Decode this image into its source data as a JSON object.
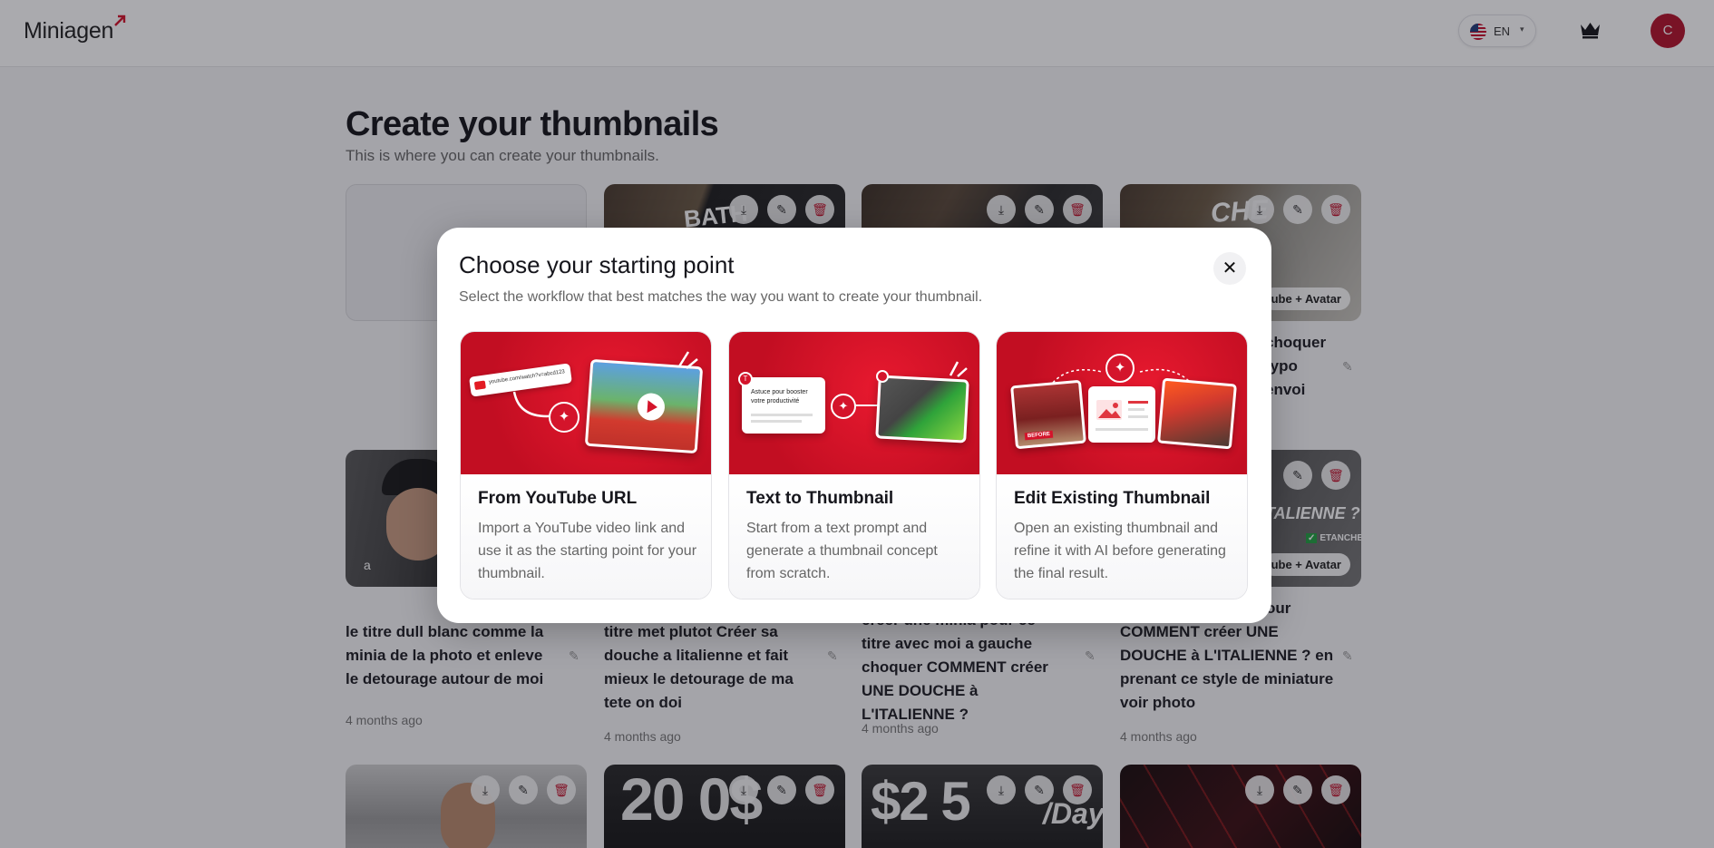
{
  "header": {
    "logo_text": "Miniagen",
    "language": "EN",
    "avatar_initial": "C"
  },
  "page": {
    "title": "Create your thumbnails",
    "subtitle": "This is where you can create your thumbnails."
  },
  "cards": {
    "r1c2_thumb_text": "BATH",
    "r1c4_thumb_text": "CHE",
    "r1c4_badge": "ube + Avatar",
    "r1c4_title": "choquer\ntypo\nenvoi",
    "r2c1_letter": "a",
    "r2c1_title": "le titre dull blanc comme la minia de la photo et enleve le detourage autour de moi",
    "r2c1_time": "4 months ago",
    "r2c2_title": "titre met plutot Créer sa douche a litalienne et fait mieux le detourage de ma tete on doi",
    "r2c2_time": "4 months ago",
    "r2c3_title": "créer une minia pour ce titre avec moi a gauche choquer COMMENT créer UNE DOUCHE à L'ITALIENNE ?",
    "r2c3_time": "4 months ago",
    "r2c4_thumb_text": "ITALIENNE ?",
    "r2c4_check": "ETANCHE",
    "r2c4_badge": "ube + Avatar",
    "r2c4_title_top": "our",
    "r2c4_title": "COMMENT créer UNE DOUCHE à L'ITALIENNE ? en prenant ce style de miniature voir photo",
    "r2c4_time": "4 months ago",
    "r3c2_thumb_text": "20 0$",
    "r3c3_thumb_text": "$2 5",
    "r3c3_thumb_sub": "/Day"
  },
  "modal": {
    "title": "Choose your starting point",
    "subtitle": "Select the workflow that best matches the way you want to create your thumbnail.",
    "close_label": "✕",
    "options": [
      {
        "title": "From YouTube URL",
        "description": "Import a YouTube video link and use it as the starting point for your thumbnail.",
        "image_text": "youtube.com/watch?v=abcd123"
      },
      {
        "title": "Text to Thumbnail",
        "description": "Start from a text prompt and generate a thumbnail concept from scratch.",
        "image_text": "Astuce pour booster votre productivité"
      },
      {
        "title": "Edit Existing Thumbnail",
        "description": "Open an existing thumbnail and refine it with AI before generating the final result.",
        "image_text": "BEFORE"
      }
    ]
  },
  "colors": {
    "brand_red": "#d4142b",
    "avatar_red": "#b3132b",
    "overlay": "rgba(20,20,30,0.36)"
  },
  "icons": [
    "download-icon",
    "pencil-icon",
    "trash-icon",
    "crown-icon",
    "close-icon",
    "chevron-down-icon"
  ]
}
